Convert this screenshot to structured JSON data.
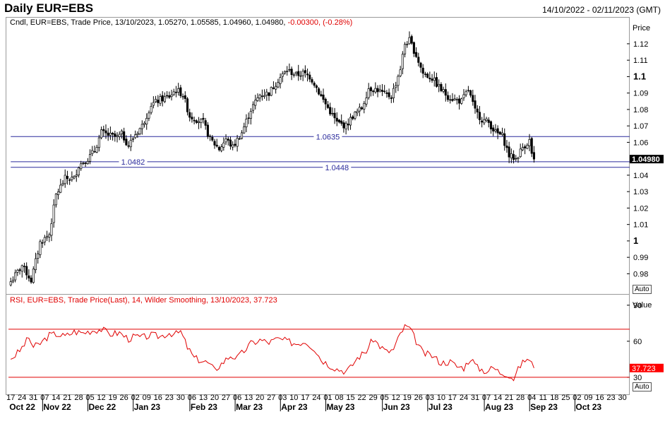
{
  "header": {
    "title": "Daily EUR=EBS",
    "date_range": "14/10/2022 - 02/11/2023 (GMT)"
  },
  "price_panel": {
    "info_prefix": "Cndl, EUR=EBS, Trade Price, 13/10/2023, 1.05270, 1.05585, 1.04960, 1.04980,",
    "info_change": "-0.00300, (-0.28%)",
    "axis_title": "Price",
    "auto_label": "Auto",
    "last_price_label": "1.04980",
    "last_price_color": "#000000",
    "candle_color": "#000000",
    "level_color": "#2b2b9c"
  },
  "rsi_panel": {
    "info": "RSI, EUR=EBS, Trade Price(Last), 14, Wilder Smoothing, 13/10/2023, 37.723",
    "axis_title": "Value",
    "auto_label": "Auto",
    "last_value_label": "37.723",
    "line_color": "#e00000"
  },
  "chart_data": [
    {
      "type": "candlestick",
      "series_name": "EUR=EBS",
      "ylim": [
        0.972,
        1.129
      ],
      "y_ticks": [
        {
          "value": 1.12,
          "label": "1.12",
          "bold": false
        },
        {
          "value": 1.11,
          "label": "1.11",
          "bold": false
        },
        {
          "value": 1.1,
          "label": "1.1",
          "bold": true
        },
        {
          "value": 1.09,
          "label": "1.09",
          "bold": false
        },
        {
          "value": 1.08,
          "label": "1.08",
          "bold": false
        },
        {
          "value": 1.07,
          "label": "1.07",
          "bold": false
        },
        {
          "value": 1.06,
          "label": "1.06",
          "bold": false
        },
        {
          "value": 1.04,
          "label": "1.04",
          "bold": false
        },
        {
          "value": 1.03,
          "label": "1.03",
          "bold": false
        },
        {
          "value": 1.02,
          "label": "1.02",
          "bold": false
        },
        {
          "value": 1.01,
          "label": "1.01",
          "bold": false
        },
        {
          "value": 1.0,
          "label": "1",
          "bold": true
        },
        {
          "value": 0.99,
          "label": "0.99",
          "bold": false
        },
        {
          "value": 0.98,
          "label": "0.98",
          "bold": false
        }
      ],
      "levels": [
        {
          "value": 1.0635,
          "label": "1.0635",
          "from_index": 0,
          "label_index": 140
        },
        {
          "value": 1.0482,
          "label": "1.0482",
          "from_index": 0,
          "label_index": 54
        },
        {
          "value": 1.0448,
          "label": "1.0448",
          "from_index": 0,
          "label_index": 144
        }
      ],
      "last_value": 1.0498,
      "anchors": [
        [
          0,
          0.9752
        ],
        [
          5,
          0.985
        ],
        [
          9,
          0.976
        ],
        [
          13,
          0.999
        ],
        [
          17,
          1.004
        ],
        [
          20,
          1.028
        ],
        [
          24,
          1.038
        ],
        [
          28,
          1.038
        ],
        [
          30,
          1.046
        ],
        [
          34,
          1.05
        ],
        [
          37,
          1.055
        ],
        [
          40,
          1.066
        ],
        [
          44,
          1.064
        ],
        [
          47,
          1.063
        ],
        [
          49,
          1.065
        ],
        [
          52,
          1.058
        ],
        [
          55,
          1.065
        ],
        [
          58,
          1.07
        ],
        [
          62,
          1.083
        ],
        [
          66,
          1.086
        ],
        [
          70,
          1.088
        ],
        [
          73,
          1.092
        ],
        [
          76,
          1.089
        ],
        [
          79,
          1.076
        ],
        [
          82,
          1.074
        ],
        [
          85,
          1.072
        ],
        [
          88,
          1.062
        ],
        [
          92,
          1.056
        ],
        [
          95,
          1.062
        ],
        [
          98,
          1.057
        ],
        [
          102,
          1.066
        ],
        [
          106,
          1.08
        ],
        [
          110,
          1.089
        ],
        [
          114,
          1.09
        ],
        [
          118,
          1.098
        ],
        [
          122,
          1.104
        ],
        [
          126,
          1.101
        ],
        [
          129,
          1.102
        ],
        [
          132,
          1.1
        ],
        [
          134,
          1.096
        ],
        [
          137,
          1.088
        ],
        [
          140,
          1.081
        ],
        [
          144,
          1.072
        ],
        [
          148,
          1.07
        ],
        [
          151,
          1.076
        ],
        [
          155,
          1.081
        ],
        [
          158,
          1.093
        ],
        [
          162,
          1.092
        ],
        [
          165,
          1.089
        ],
        [
          168,
          1.088
        ],
        [
          170,
          1.096
        ],
        [
          172,
          1.105
        ],
        [
          174,
          1.12
        ],
        [
          176,
          1.122
        ],
        [
          179,
          1.113
        ],
        [
          182,
          1.102
        ],
        [
          186,
          1.099
        ],
        [
          190,
          1.092
        ],
        [
          193,
          1.088
        ],
        [
          196,
          1.086
        ],
        [
          199,
          1.085
        ],
        [
          202,
          1.092
        ],
        [
          205,
          1.079
        ],
        [
          208,
          1.074
        ],
        [
          211,
          1.072
        ],
        [
          214,
          1.066
        ],
        [
          217,
          1.064
        ],
        [
          220,
          1.052
        ],
        [
          223,
          1.05
        ],
        [
          226,
          1.057
        ],
        [
          229,
          1.061
        ],
        [
          230,
          1.053
        ],
        [
          231,
          1.0498
        ]
      ],
      "x_ticks": [
        {
          "label": "17",
          "index": 0
        },
        {
          "label": "24",
          "index": 5
        },
        {
          "label": "31",
          "index": 10
        },
        {
          "label": "07",
          "index": 15
        },
        {
          "label": "14",
          "index": 20
        },
        {
          "label": "21",
          "index": 25
        },
        {
          "label": "28",
          "index": 30
        },
        {
          "label": "05",
          "index": 35
        },
        {
          "label": "12",
          "index": 40
        },
        {
          "label": "19",
          "index": 45
        },
        {
          "label": "26",
          "index": 50
        },
        {
          "label": "02",
          "index": 55
        },
        {
          "label": "09",
          "index": 60
        },
        {
          "label": "16",
          "index": 65
        },
        {
          "label": "23",
          "index": 70
        },
        {
          "label": "30",
          "index": 75
        },
        {
          "label": "06",
          "index": 80
        },
        {
          "label": "13",
          "index": 85
        },
        {
          "label": "20",
          "index": 90
        },
        {
          "label": "27",
          "index": 95
        },
        {
          "label": "06",
          "index": 100
        },
        {
          "label": "13",
          "index": 105
        },
        {
          "label": "20",
          "index": 110
        },
        {
          "label": "27",
          "index": 115
        },
        {
          "label": "03",
          "index": 120
        },
        {
          "label": "10",
          "index": 125
        },
        {
          "label": "17",
          "index": 130
        },
        {
          "label": "24",
          "index": 135
        },
        {
          "label": "01",
          "index": 140
        },
        {
          "label": "08",
          "index": 145
        },
        {
          "label": "15",
          "index": 150
        },
        {
          "label": "22",
          "index": 155
        },
        {
          "label": "29",
          "index": 160
        },
        {
          "label": "05",
          "index": 165
        },
        {
          "label": "12",
          "index": 170
        },
        {
          "label": "19",
          "index": 175
        },
        {
          "label": "26",
          "index": 180
        },
        {
          "label": "03",
          "index": 185
        },
        {
          "label": "10",
          "index": 190
        },
        {
          "label": "17",
          "index": 195
        },
        {
          "label": "24",
          "index": 200
        },
        {
          "label": "31",
          "index": 205
        },
        {
          "label": "07",
          "index": 210
        },
        {
          "label": "14",
          "index": 215
        },
        {
          "label": "21",
          "index": 220
        },
        {
          "label": "28",
          "index": 225
        },
        {
          "label": "04",
          "index": 230
        },
        {
          "label": "11",
          "index": 235
        },
        {
          "label": "18",
          "index": 240
        },
        {
          "label": "25",
          "index": 245
        },
        {
          "label": "02",
          "index": 250
        },
        {
          "label": "09",
          "index": 255
        },
        {
          "label": "16",
          "index": 260
        },
        {
          "label": "23",
          "index": 265
        },
        {
          "label": "30",
          "index": 270
        }
      ],
      "month_labels": [
        {
          "label": "Oct 22",
          "index": 0
        },
        {
          "label": "Nov 22",
          "index": 15
        },
        {
          "label": "Dec 22",
          "index": 35
        },
        {
          "label": "Jan 23",
          "index": 55
        },
        {
          "label": "Feb 23",
          "index": 80
        },
        {
          "label": "Mar 23",
          "index": 100
        },
        {
          "label": "Apr 23",
          "index": 120
        },
        {
          "label": "May 23",
          "index": 140
        },
        {
          "label": "Jun 23",
          "index": 165
        },
        {
          "label": "Jul 23",
          "index": 185
        },
        {
          "label": "Aug 23",
          "index": 210
        },
        {
          "label": "Sep 23",
          "index": 230
        },
        {
          "label": "Oct 23",
          "index": 250
        }
      ],
      "month_dividers": [
        15,
        35,
        55,
        80,
        100,
        120,
        140,
        165,
        185,
        210,
        230,
        250
      ],
      "index_range": [
        -1,
        272
      ]
    },
    {
      "type": "line",
      "series_name": "RSI",
      "ylim": [
        17,
        97
      ],
      "y_ticks": [
        {
          "value": 90,
          "label": "90"
        },
        {
          "value": 60,
          "label": "60"
        },
        {
          "value": 30,
          "label": "30"
        }
      ],
      "levels": [
        70,
        30
      ],
      "last_value": 37.723,
      "anchors": [
        [
          0,
          45
        ],
        [
          4,
          52
        ],
        [
          8,
          63
        ],
        [
          10,
          55
        ],
        [
          13,
          58
        ],
        [
          17,
          65
        ],
        [
          20,
          66
        ],
        [
          24,
          64
        ],
        [
          28,
          68
        ],
        [
          32,
          67
        ],
        [
          36,
          69
        ],
        [
          40,
          70
        ],
        [
          44,
          66
        ],
        [
          48,
          67
        ],
        [
          52,
          62
        ],
        [
          55,
          64
        ],
        [
          58,
          63
        ],
        [
          62,
          65
        ],
        [
          66,
          64
        ],
        [
          70,
          67
        ],
        [
          73,
          66
        ],
        [
          75,
          68
        ],
        [
          78,
          55
        ],
        [
          81,
          46
        ],
        [
          84,
          44
        ],
        [
          87,
          42
        ],
        [
          90,
          36
        ],
        [
          94,
          43
        ],
        [
          97,
          48
        ],
        [
          100,
          46
        ],
        [
          103,
          52
        ],
        [
          106,
          58
        ],
        [
          110,
          61
        ],
        [
          114,
          59
        ],
        [
          118,
          62
        ],
        [
          122,
          60
        ],
        [
          126,
          58
        ],
        [
          130,
          60
        ],
        [
          134,
          54
        ],
        [
          137,
          45
        ],
        [
          140,
          41
        ],
        [
          144,
          37
        ],
        [
          148,
          35
        ],
        [
          150,
          38
        ],
        [
          153,
          46
        ],
        [
          157,
          52
        ],
        [
          160,
          62
        ],
        [
          163,
          56
        ],
        [
          166,
          51
        ],
        [
          169,
          53
        ],
        [
          172,
          66
        ],
        [
          174,
          72
        ],
        [
          176,
          71
        ],
        [
          179,
          60
        ],
        [
          182,
          50
        ],
        [
          186,
          48
        ],
        [
          190,
          42
        ],
        [
          194,
          43
        ],
        [
          197,
          39
        ],
        [
          200,
          38
        ],
        [
          203,
          46
        ],
        [
          206,
          38
        ],
        [
          210,
          35
        ],
        [
          213,
          38
        ],
        [
          216,
          34
        ],
        [
          219,
          33
        ],
        [
          222,
          29
        ],
        [
          225,
          40
        ],
        [
          228,
          46
        ],
        [
          230,
          41
        ],
        [
          231,
          37.723
        ]
      ],
      "index_range": [
        -1,
        272
      ]
    }
  ]
}
